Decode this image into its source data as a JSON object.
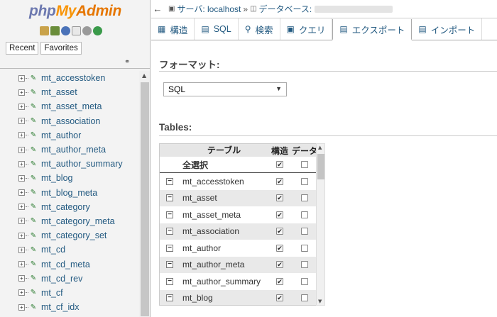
{
  "nav": {
    "logo": {
      "php": "php",
      "my": "My",
      "admin": "Admin"
    },
    "tabs": {
      "recent": "Recent",
      "favorites": "Favorites"
    },
    "link_icon": "link-icon",
    "tree_items": [
      "mt_accesstoken",
      "mt_asset",
      "mt_asset_meta",
      "mt_association",
      "mt_author",
      "mt_author_meta",
      "mt_author_summary",
      "mt_blog",
      "mt_blog_meta",
      "mt_category",
      "mt_category_meta",
      "mt_category_set",
      "mt_cd",
      "mt_cd_meta",
      "mt_cd_rev",
      "mt_cf",
      "mt_cf_idx"
    ]
  },
  "breadcrumb": {
    "server_label": "サーバ: localhost",
    "separator": "»",
    "database_label": "データベース:"
  },
  "tabs": [
    {
      "id": "structure",
      "label": "構造",
      "icon": "structure-icon"
    },
    {
      "id": "sql",
      "label": "SQL",
      "icon": "sql-icon"
    },
    {
      "id": "search",
      "label": "検索",
      "icon": "search-icon"
    },
    {
      "id": "query",
      "label": "クエリ",
      "icon": "query-icon"
    },
    {
      "id": "export",
      "label": "エクスポート",
      "icon": "export-icon",
      "active": true
    },
    {
      "id": "import",
      "label": "インポート",
      "icon": "import-icon"
    }
  ],
  "export": {
    "format_title": "フォーマット:",
    "format_value": "SQL",
    "tables_title": "Tables:",
    "columns": {
      "table": "テーブル",
      "structure": "構造",
      "data": "データ"
    },
    "select_all": "全選択",
    "rows": [
      {
        "name": "mt_accesstoken",
        "structure": true,
        "data": false
      },
      {
        "name": "mt_asset",
        "structure": true,
        "data": false
      },
      {
        "name": "mt_asset_meta",
        "structure": true,
        "data": false
      },
      {
        "name": "mt_association",
        "structure": true,
        "data": false
      },
      {
        "name": "mt_author",
        "structure": true,
        "data": false
      },
      {
        "name": "mt_author_meta",
        "structure": true,
        "data": false
      },
      {
        "name": "mt_author_summary",
        "structure": true,
        "data": false
      },
      {
        "name": "mt_blog",
        "structure": true,
        "data": false
      }
    ]
  }
}
